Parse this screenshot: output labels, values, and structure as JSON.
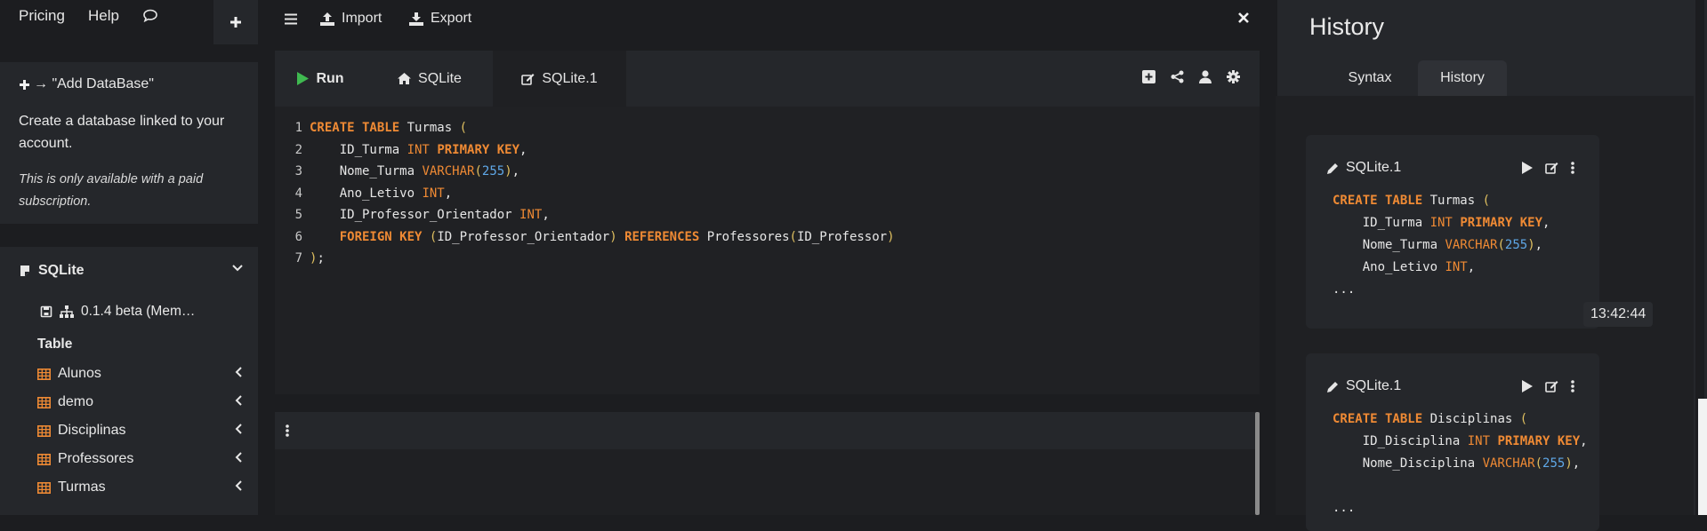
{
  "topnav": {
    "pricing": "Pricing",
    "help": "Help"
  },
  "add_database": {
    "title": "→ \"Add DataBase\"",
    "description": "Create a database linked to your account.",
    "note": "This is only available with a paid subscription."
  },
  "database": {
    "name": "SQLite",
    "version": "0.1.4 beta (Mem…",
    "table_label": "Table",
    "tables": [
      "Alunos",
      "demo",
      "Disciplinas",
      "Professores",
      "Turmas"
    ]
  },
  "toolbar": {
    "import": "Import",
    "export": "Export"
  },
  "editor": {
    "run": "Run",
    "tab_db": "SQLite",
    "tab_file": "SQLite.1",
    "line_numbers": [
      "1",
      "2",
      "3",
      "4",
      "5",
      "6",
      "7"
    ],
    "lines": [
      [
        [
          "kw",
          "CREATE TABLE"
        ],
        [
          "tx",
          " Turmas "
        ],
        [
          "pn",
          "("
        ]
      ],
      [
        [
          "tx",
          "    ID_Turma "
        ],
        [
          "ty",
          "INT"
        ],
        [
          "tx",
          " "
        ],
        [
          "kw",
          "PRIMARY KEY"
        ],
        [
          "tx",
          ","
        ]
      ],
      [
        [
          "tx",
          "    Nome_Turma "
        ],
        [
          "ty",
          "VARCHAR"
        ],
        [
          "pn",
          "("
        ],
        [
          "nm",
          "255"
        ],
        [
          "pn",
          ")"
        ],
        [
          "tx",
          ","
        ]
      ],
      [
        [
          "tx",
          "    Ano_Letivo "
        ],
        [
          "ty",
          "INT"
        ],
        [
          "tx",
          ","
        ]
      ],
      [
        [
          "tx",
          "    ID_Professor_Orientador "
        ],
        [
          "ty",
          "INT"
        ],
        [
          "tx",
          ","
        ]
      ],
      [
        [
          "tx",
          "    "
        ],
        [
          "kw",
          "FOREIGN KEY"
        ],
        [
          "tx",
          " "
        ],
        [
          "pn",
          "("
        ],
        [
          "tx",
          "ID_Professor_Orientador"
        ],
        [
          "pn",
          ")"
        ],
        [
          "tx",
          " "
        ],
        [
          "kw",
          "REFERENCES"
        ],
        [
          "tx",
          " Professores"
        ],
        [
          "pn",
          "("
        ],
        [
          "tx",
          "ID_Professor"
        ],
        [
          "pn",
          ")"
        ]
      ],
      [
        [
          "pn",
          ")"
        ],
        [
          "tx",
          ";"
        ]
      ]
    ]
  },
  "history": {
    "title": "History",
    "tabs": [
      "Syntax",
      "History"
    ],
    "entries": [
      {
        "name": "SQLite.1",
        "time": "13:42:44",
        "lines": [
          [
            [
              "kw",
              "CREATE TABLE"
            ],
            [
              "tx",
              " Turmas "
            ],
            [
              "pn",
              "("
            ]
          ],
          [
            [
              "tx",
              "    ID_Turma "
            ],
            [
              "ty",
              "INT"
            ],
            [
              "tx",
              " "
            ],
            [
              "kw",
              "PRIMARY KEY"
            ],
            [
              "tx",
              ","
            ]
          ],
          [
            [
              "tx",
              "    Nome_Turma "
            ],
            [
              "ty",
              "VARCHAR"
            ],
            [
              "pn",
              "("
            ],
            [
              "nm",
              "255"
            ],
            [
              "pn",
              ")"
            ],
            [
              "tx",
              ","
            ]
          ],
          [
            [
              "tx",
              "    Ano_Letivo "
            ],
            [
              "ty",
              "INT"
            ],
            [
              "tx",
              ","
            ]
          ],
          [
            [
              "tx",
              "..."
            ]
          ]
        ]
      },
      {
        "name": "SQLite.1",
        "lines": [
          [
            [
              "kw",
              "CREATE TABLE"
            ],
            [
              "tx",
              " Disciplinas "
            ],
            [
              "pn",
              "("
            ]
          ],
          [
            [
              "tx",
              "    ID_Disciplina "
            ],
            [
              "ty",
              "INT"
            ],
            [
              "tx",
              " "
            ],
            [
              "kw",
              "PRIMARY KEY"
            ],
            [
              "tx",
              ","
            ]
          ],
          [
            [
              "tx",
              "    Nome_Disciplina "
            ],
            [
              "ty",
              "VARCHAR"
            ],
            [
              "pn",
              "("
            ],
            [
              "nm",
              "255"
            ],
            [
              "pn",
              ")"
            ],
            [
              "tx",
              ","
            ]
          ],
          [
            [
              "tx",
              ""
            ]
          ],
          [
            [
              "tx",
              "..."
            ]
          ]
        ]
      }
    ]
  }
}
